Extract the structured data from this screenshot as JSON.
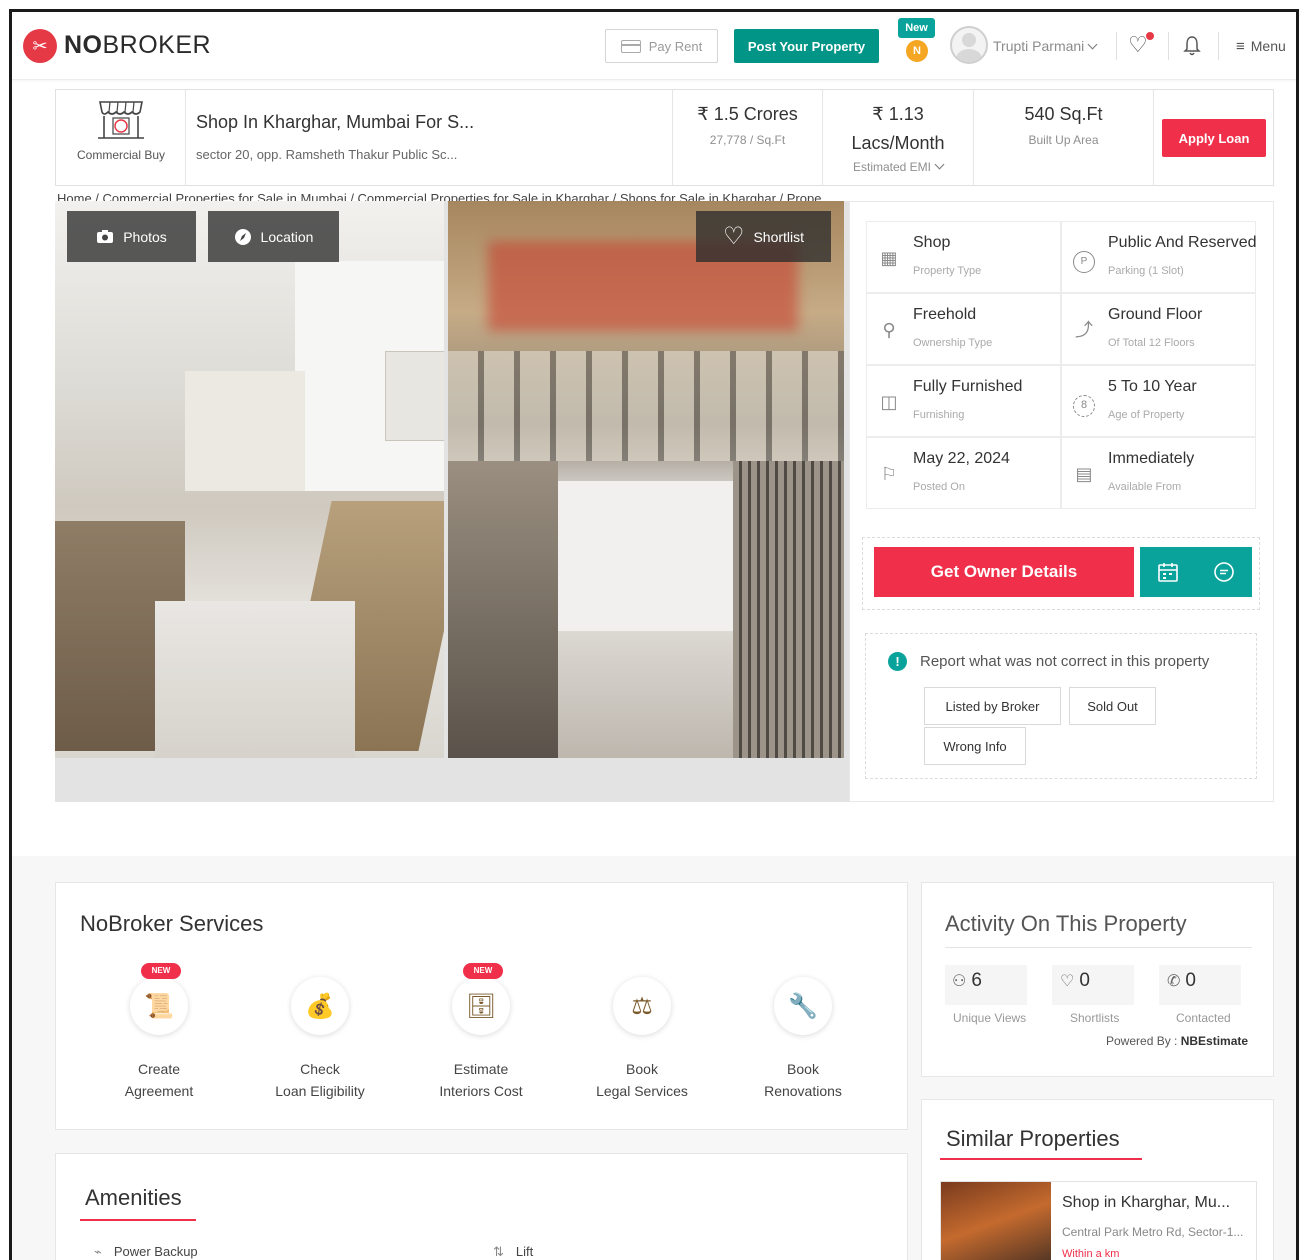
{
  "header": {
    "logo_text": "NOBROKER",
    "pay_rent": "Pay Rent",
    "post_property": "Post Your Property",
    "new_badge": "New",
    "coin_letter": "N",
    "user_name": "Trupti Parmani",
    "menu": "Menu",
    "accent": "#0aa39b",
    "brand": "#e63946"
  },
  "summary": {
    "type_label": "Commercial Buy",
    "title": "Shop In Kharghar, Mumbai For S...",
    "address": "sector 20, opp. Ramsheth Thakur Public Sc...",
    "price": "₹ 1.5 Crores",
    "price_per_sqft": "27,778 / Sq.Ft",
    "emi_line1": "₹ 1.13",
    "emi_line2": "Lacs/Month",
    "emi_label": "Estimated EMI",
    "area": "540 Sq.Ft",
    "area_label": "Built Up Area",
    "apply_loan": "Apply Loan"
  },
  "breadcrumb": "Home / Commercial Properties for Sale in Mumbai / Commercial Properties for Sale in Kharghar / Shops for Sale in Kharghar / Prope",
  "gallery": {
    "photos_btn": "Photos",
    "location_btn": "Location",
    "shortlist_btn": "Shortlist"
  },
  "details": [
    {
      "value": "Shop",
      "label": "Property Type",
      "icon": "building-icon"
    },
    {
      "value": "Public And Reserved",
      "label": "Parking (1 Slot)",
      "icon": "parking-icon"
    },
    {
      "value": "Freehold",
      "label": "Ownership Type",
      "icon": "owner-icon"
    },
    {
      "value": "Ground Floor",
      "label": "Of Total 12 Floors",
      "icon": "stairs-icon"
    },
    {
      "value": "Fully Furnished",
      "label": "Furnishing",
      "icon": "furniture-icon"
    },
    {
      "value": "5 To 10 Year",
      "label": "Age of Property",
      "icon": "age-icon"
    },
    {
      "value": "May 22, 2024",
      "label": "Posted On",
      "icon": "flag-icon"
    },
    {
      "value": "Immediately",
      "label": "Available From",
      "icon": "calendar-icon"
    }
  ],
  "owner": {
    "button": "Get Owner Details"
  },
  "report": {
    "title": "Report what was not correct in this property",
    "chips": [
      "Listed by Broker",
      "Sold Out",
      "Wrong Info"
    ]
  },
  "services": {
    "title": "NoBroker Services",
    "new_tag": "NEW",
    "items": [
      {
        "line1": "Create",
        "line2": "Agreement",
        "is_new": true,
        "icon": "agreement-icon"
      },
      {
        "line1": "Check",
        "line2": "Loan Eligibility",
        "is_new": false,
        "icon": "money-bag-icon"
      },
      {
        "line1": "Estimate",
        "line2": "Interiors Cost",
        "is_new": true,
        "icon": "interiors-icon"
      },
      {
        "line1": "Book",
        "line2": "Legal Services",
        "is_new": false,
        "icon": "gavel-icon"
      },
      {
        "line1": "Book",
        "line2": "Renovations",
        "is_new": false,
        "icon": "wrench-icon"
      }
    ]
  },
  "activity": {
    "title": "Activity On This Property",
    "stats": [
      {
        "value": "6",
        "label": "Unique Views",
        "icon": "user-icon"
      },
      {
        "value": "0",
        "label": "Shortlists",
        "icon": "heart-icon"
      },
      {
        "value": "0",
        "label": "Contacted",
        "icon": "phone-icon"
      }
    ],
    "powered_label": "Powered By :",
    "powered_by": "NBEstimate"
  },
  "amenities": {
    "title": "Amenities",
    "items": [
      "Power Backup",
      "Lift"
    ]
  },
  "similar": {
    "title": "Similar Properties",
    "item_title": "Shop in Kharghar, Mu...",
    "item_address": "Central Park Metro Rd, Sector-1...",
    "item_distance": "Within a km"
  }
}
